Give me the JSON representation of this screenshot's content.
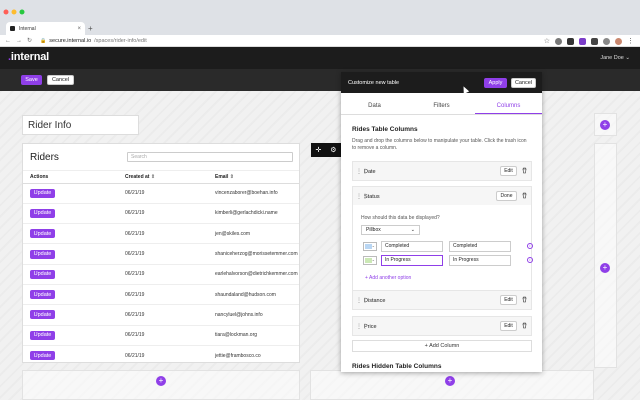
{
  "browser": {
    "tab_title": "Internal",
    "tab_close": "×",
    "new_tab": "+",
    "url_domain": "secure.internal.io",
    "url_path": "/spaces/rider-info/edit"
  },
  "app": {
    "logo_dot": ".",
    "logo_text": "internal",
    "user_menu": "Jane Doe ⌄"
  },
  "editbar": {
    "save_label": "Save",
    "cancel_label": "Cancel"
  },
  "page_title": "Rider Info",
  "riders": {
    "title": "Riders",
    "search_placeholder": "Search",
    "columns": [
      "Actions",
      "Created at",
      "Email"
    ],
    "sort_glyph": "⇕",
    "rows": [
      {
        "action": "Update",
        "created": "06/21/19",
        "email": "vincenzaborer@boehan.info"
      },
      {
        "action": "Update",
        "created": "06/21/19",
        "email": "kimberli@gerlachdicki.name"
      },
      {
        "action": "Update",
        "created": "06/21/19",
        "email": "jen@skiles.com"
      },
      {
        "action": "Update",
        "created": "06/21/19",
        "email": "shaniceherzog@morissetemmer.com"
      },
      {
        "action": "Update",
        "created": "06/21/19",
        "email": "earlehalvorson@dietrichkemmer.com"
      },
      {
        "action": "Update",
        "created": "06/21/19",
        "email": "shaundaland@hudson.com"
      },
      {
        "action": "Update",
        "created": "06/21/19",
        "email": "nancyluel@johns.info"
      },
      {
        "action": "Update",
        "created": "06/21/19",
        "email": "tiara@lockman.org"
      },
      {
        "action": "Update",
        "created": "06/21/19",
        "email": "jettie@frambosco.co"
      }
    ]
  },
  "modal": {
    "title": "Customize new table",
    "apply_label": "Apply",
    "cancel_label": "Cancel",
    "tabs": [
      "Data",
      "Filters",
      "Columns"
    ],
    "section_title": "Rides Table Columns",
    "section_desc": "Drag and drop the columns below to manipulate your table. Click the trash icon to remove a column.",
    "columns": [
      {
        "name": "Date",
        "action": "Edit"
      },
      {
        "name": "Status",
        "action": "Done"
      },
      {
        "name": "Distance",
        "action": "Edit"
      },
      {
        "name": "Price",
        "action": "Edit"
      }
    ],
    "status_question": "How should this data be displayed?",
    "display_select": "Pillbox",
    "options": [
      {
        "value": "Completed",
        "label": "Completed",
        "color": "#b9d6f3"
      },
      {
        "value": "In Progress",
        "label": "In Progress",
        "color": "#cbe8b5"
      }
    ],
    "add_option": "+ Add another option",
    "add_column": "+ Add Column",
    "hidden_title": "Rides Hidden Table Columns"
  },
  "colors": {
    "accent": "#8f3fe8",
    "header": "#1c1c1c",
    "editbar": "#2a2a2a"
  }
}
